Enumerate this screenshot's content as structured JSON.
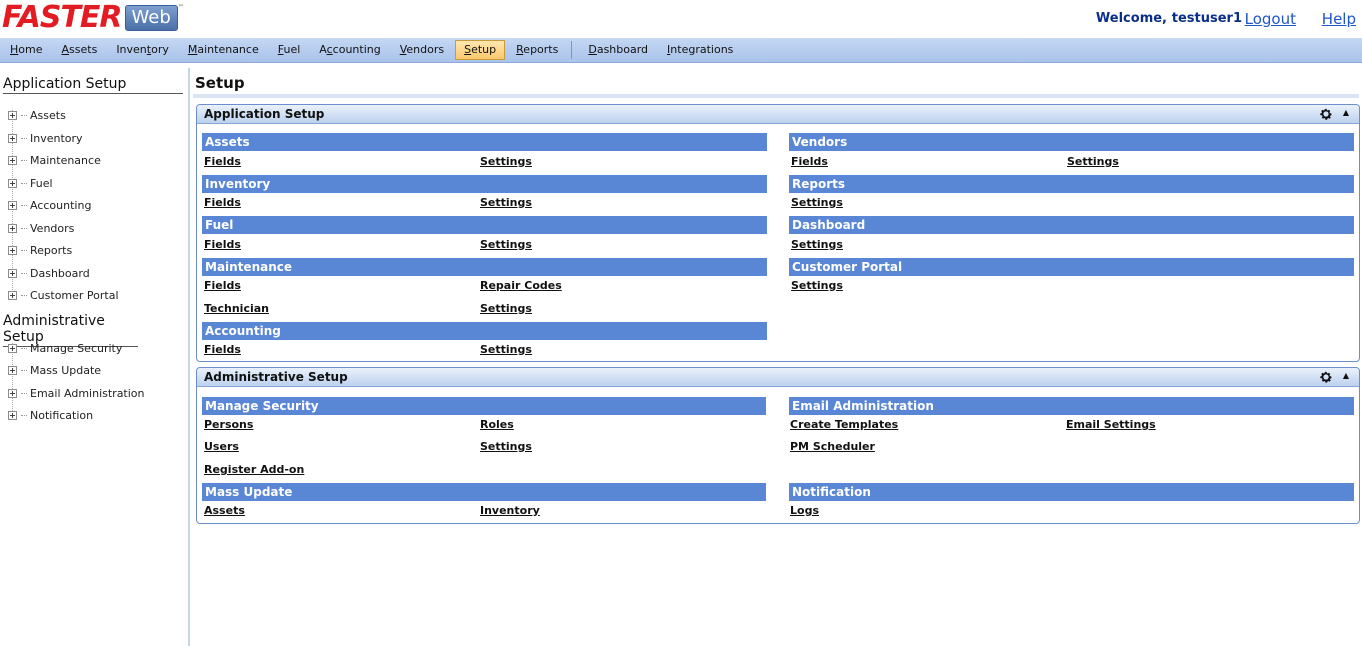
{
  "header": {
    "logo_text": "FASTER",
    "logo_web": "Web",
    "welcome": "Welcome,",
    "username": "testuser1",
    "logout": "Logout",
    "help": "Help"
  },
  "nav": {
    "items": [
      "Home",
      "Assets",
      "Inventory",
      "Maintenance",
      "Fuel",
      "Accounting",
      "Vendors",
      "Setup",
      "Reports",
      "Dashboard",
      "Integrations"
    ],
    "active": "Setup"
  },
  "sidebar": {
    "app_title": "Application Setup",
    "app_items": [
      "Assets",
      "Inventory",
      "Maintenance",
      "Fuel",
      "Accounting",
      "Vendors",
      "Reports",
      "Dashboard",
      "Customer Portal"
    ],
    "admin_title": "Administrative Setup",
    "admin_items": [
      "Manage Security",
      "Mass Update",
      "Email Administration",
      "Notification"
    ]
  },
  "main": {
    "title": "Setup",
    "app_panel": {
      "title": "Application Setup",
      "groups": [
        {
          "name": "Assets",
          "links": [
            "Fields",
            "Settings"
          ]
        },
        {
          "name": "Inventory",
          "links": [
            "Fields",
            "Settings"
          ]
        },
        {
          "name": "Fuel",
          "links": [
            "Fields",
            "Settings"
          ]
        },
        {
          "name": "Maintenance",
          "links": [
            "Fields",
            "Repair Codes",
            "Technician",
            "Settings"
          ]
        },
        {
          "name": "Accounting",
          "links": [
            "Fields",
            "Settings"
          ]
        },
        {
          "name": "Vendors",
          "links": [
            "Fields",
            "Settings"
          ]
        },
        {
          "name": "Reports",
          "links": [
            "Settings"
          ]
        },
        {
          "name": "Dashboard",
          "links": [
            "Settings"
          ]
        },
        {
          "name": "Customer Portal",
          "links": [
            "Settings"
          ]
        }
      ]
    },
    "admin_panel": {
      "title": "Administrative Setup",
      "groups": [
        {
          "name": "Manage Security",
          "links": [
            "Persons",
            "Roles",
            "Users",
            "Settings",
            "Register Add-on"
          ]
        },
        {
          "name": "Mass Update",
          "links": [
            "Assets",
            "Inventory"
          ]
        },
        {
          "name": "Email Administration",
          "links": [
            "Create Templates",
            "Email Settings",
            "PM Scheduler"
          ]
        },
        {
          "name": "Notification",
          "links": [
            "Logs"
          ]
        }
      ]
    }
  }
}
